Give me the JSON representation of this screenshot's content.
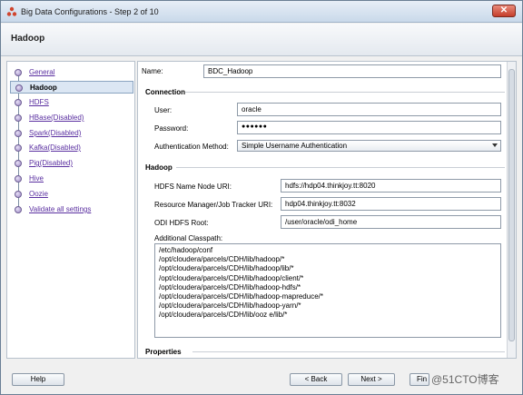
{
  "window": {
    "title": "Big Data Configurations - Step 2 of 10",
    "close_label": "✕"
  },
  "header": {
    "title": "Hadoop"
  },
  "nav": {
    "items": [
      {
        "label": "General"
      },
      {
        "label": "Hadoop"
      },
      {
        "label": "HDFS"
      },
      {
        "label": "HBase(Disabled)"
      },
      {
        "label": "Spark(Disabled)"
      },
      {
        "label": "Kafka(Disabled)"
      },
      {
        "label": "Pig(Disabled)"
      },
      {
        "label": "Hive"
      },
      {
        "label": "Oozie"
      },
      {
        "label": "Validate all settings"
      }
    ]
  },
  "form": {
    "name_label": "Name:",
    "name_value": "BDC_Hadoop",
    "connection_title": "Connection",
    "user_label": "User:",
    "user_value": "oracle",
    "password_label": "Password:",
    "password_value": "●●●●●●",
    "auth_label": "Authentication Method:",
    "auth_value": "Simple Username Authentication",
    "hadoop_title": "Hadoop",
    "hdfs_uri_label": "HDFS Name Node URI:",
    "hdfs_uri_value": "hdfs://hdp04.thinkjoy.tt:8020",
    "rm_label": "Resource Manager/Job Tracker URI:",
    "rm_value": "hdp04.thinkjoy.tt:8032",
    "odi_root_label": "ODI HDFS Root:",
    "odi_root_value": "/user/oracle/odi_home",
    "classpath_label": "Additional Classpath:",
    "classpath_lines": [
      "/etc/hadoop/conf",
      "/opt/cloudera/parcels/CDH/lib/hadoop/*",
      "/opt/cloudera/parcels/CDH/lib/hadoop/lib/*",
      "/opt/cloudera/parcels/CDH/lib/hadoop/client/*",
      "/opt/cloudera/parcels/CDH/lib/hadoop-hdfs/*",
      "/opt/cloudera/parcels/CDH/lib/hadoop-mapreduce/*",
      "/opt/cloudera/parcels/CDH/lib/hadoop-yarn/*",
      "/opt/cloudera/parcels/CDH/lib/ooz e/lib/*"
    ],
    "properties_title": "Properties"
  },
  "buttons": {
    "help": "Help",
    "back": "< Back",
    "next": "Next >",
    "finish": "Fin"
  },
  "watermark": "@51CTO博客"
}
